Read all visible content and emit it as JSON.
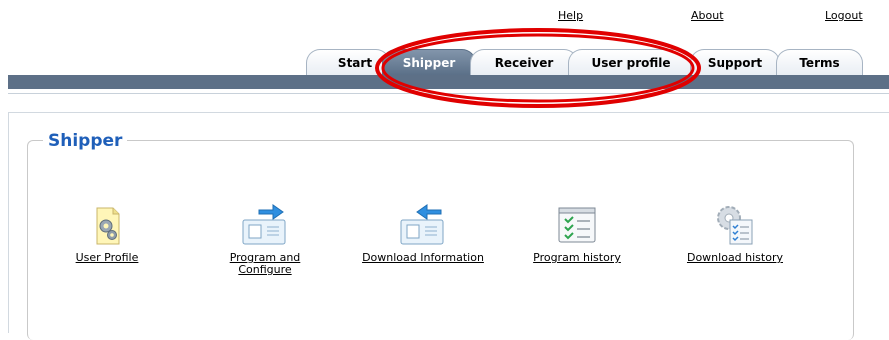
{
  "top_links": {
    "help": "Help",
    "about": "About",
    "logout": "Logout"
  },
  "tabs": [
    {
      "label": "Start",
      "active": false
    },
    {
      "label": "Shipper",
      "active": true
    },
    {
      "label": "Receiver",
      "active": false
    },
    {
      "label": "User profile",
      "active": false
    },
    {
      "label": "Support",
      "active": false
    },
    {
      "label": "Terms",
      "active": false
    }
  ],
  "section_title": "Shipper",
  "items": [
    {
      "label": "User Profile",
      "icon": "gear-document-icon"
    },
    {
      "label_line1": "Program and",
      "label_line2": "Configure",
      "icon": "upload-arrow-device-icon"
    },
    {
      "label": "Download Information",
      "icon": "download-arrow-device-icon"
    },
    {
      "label": "Program history",
      "icon": "checklist-window-icon"
    },
    {
      "label": "Download history",
      "icon": "gear-checklist-icon"
    }
  ],
  "colors": {
    "accent_blue": "#1f5fb9",
    "nav_bar": "#5d7087",
    "highlight": "#e00000"
  }
}
